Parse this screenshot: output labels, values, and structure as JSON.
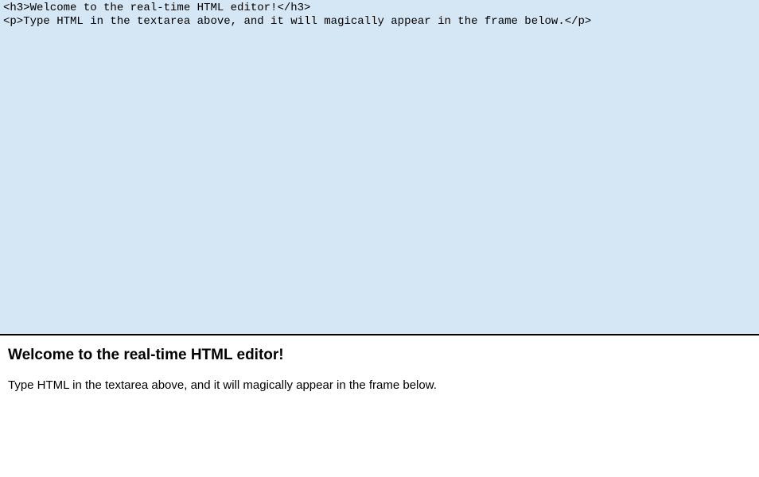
{
  "editor": {
    "source": "<h3>Welcome to the real-time HTML editor!</h3>\n<p>Type HTML in the textarea above, and it will magically appear in the frame below.</p>"
  },
  "preview": {
    "heading": "Welcome to the real-time HTML editor!",
    "paragraph": "Type HTML in the textarea above, and it will magically appear in the frame below."
  }
}
